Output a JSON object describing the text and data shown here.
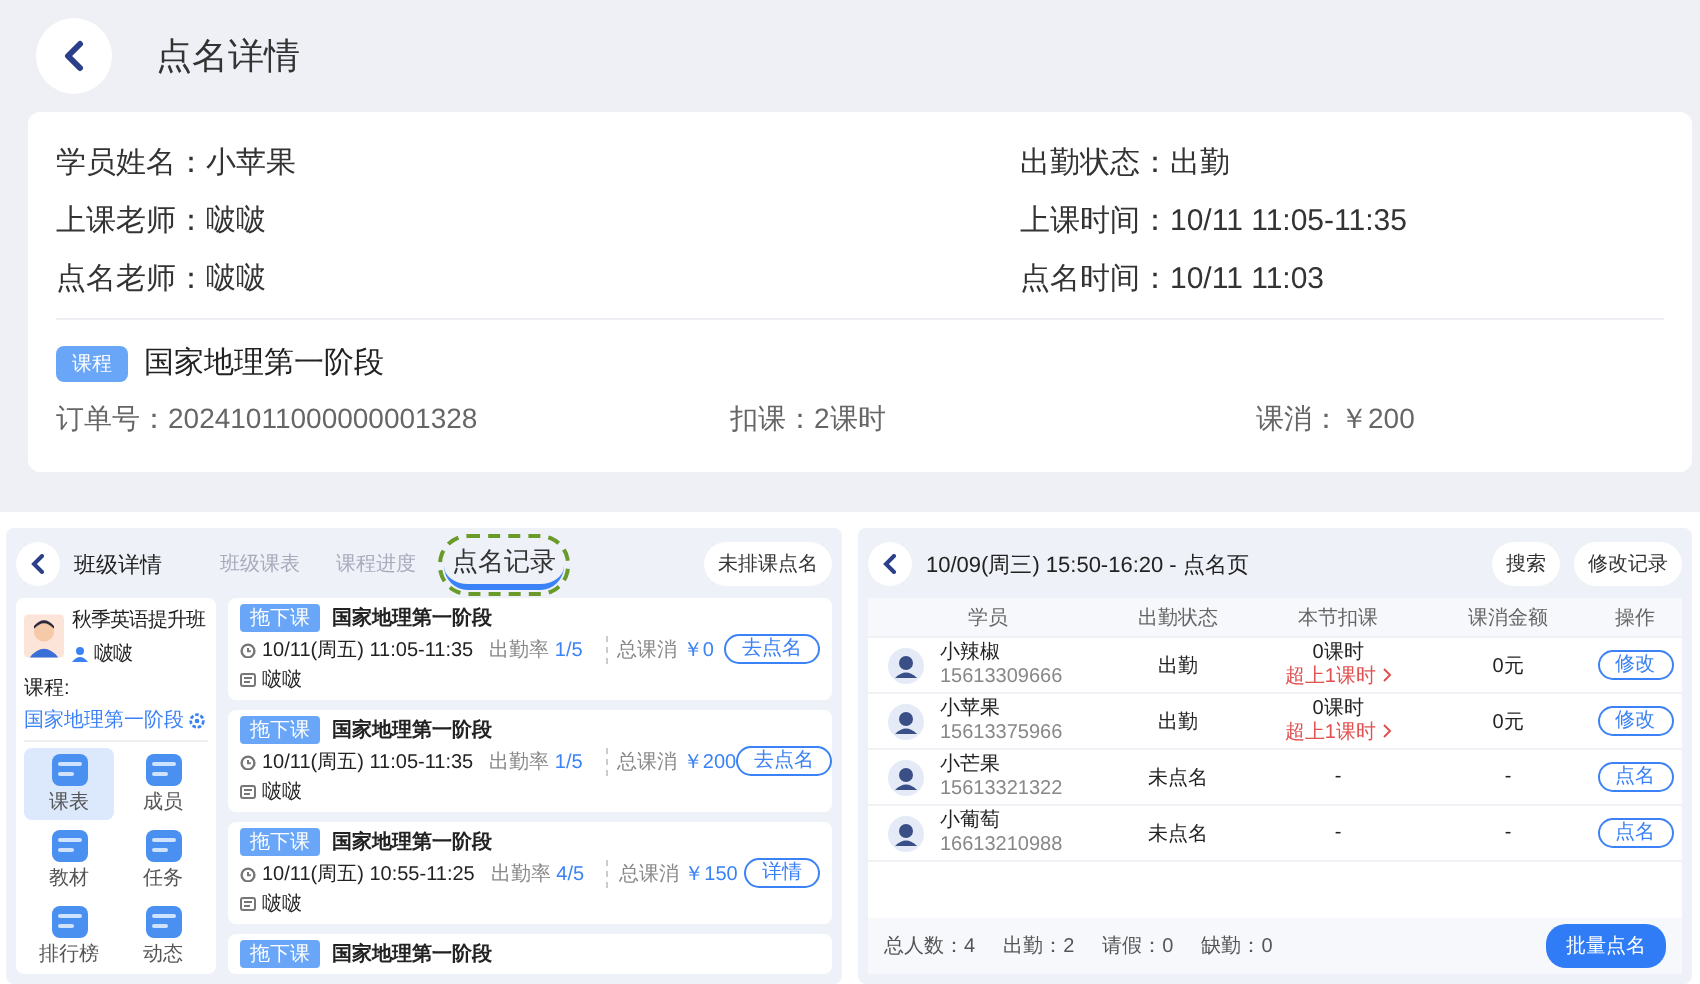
{
  "header": {
    "title": "点名详情"
  },
  "detail": {
    "fields": [
      {
        "label": "学员姓名：",
        "value": "小苹果"
      },
      {
        "label": "出勤状态：",
        "value": "出勤"
      },
      {
        "label": "上课老师：",
        "value": "啵啵"
      },
      {
        "label": "上课时间：",
        "value": "10/11 11:05-11:35"
      },
      {
        "label": "点名老师：",
        "value": "啵啵"
      },
      {
        "label": "点名时间：",
        "value": "10/11 11:03"
      }
    ],
    "course_tag": "课程",
    "course": "国家地理第一阶段",
    "meta": [
      {
        "label": "订单号：",
        "value": "20241011000000001328"
      },
      {
        "label": "扣课：",
        "value": "2课时"
      },
      {
        "label": "课消：",
        "value": "￥200"
      }
    ]
  },
  "class_panel": {
    "title": "班级详情",
    "tabs": [
      {
        "label": "班级课表",
        "selected": false,
        "circled": false
      },
      {
        "label": "课程进度",
        "selected": false,
        "circled": false
      },
      {
        "label": "点名记录",
        "selected": true,
        "circled": true
      }
    ],
    "action": "未排课点名",
    "class_name": "秋季英语提升班",
    "teacher": "啵啵",
    "course_label": "课程:",
    "course": "国家地理第一阶段",
    "menu": [
      {
        "label": "课表",
        "selected": true
      },
      {
        "label": "成员",
        "selected": false
      },
      {
        "label": "教材",
        "selected": false
      },
      {
        "label": "任务",
        "selected": false
      },
      {
        "label": "排行榜",
        "selected": false
      },
      {
        "label": "动态",
        "selected": false
      }
    ],
    "records": [
      {
        "tag": "拖下课",
        "title": "国家地理第一阶段",
        "time": "10/11(周五) 11:05-11:35",
        "teacher": "啵啵",
        "rate_label": "出勤率",
        "rate": "1/5",
        "total_label": "总课消",
        "total": "￥0",
        "action": "去点名"
      },
      {
        "tag": "拖下课",
        "title": "国家地理第一阶段",
        "time": "10/11(周五) 11:05-11:35",
        "teacher": "啵啵",
        "rate_label": "出勤率",
        "rate": "1/5",
        "total_label": "总课消",
        "total": "￥200",
        "action": "去点名"
      },
      {
        "tag": "拖下课",
        "title": "国家地理第一阶段",
        "time": "10/11(周五) 10:55-11:25",
        "teacher": "啵啵",
        "rate_label": "出勤率",
        "rate": "4/5",
        "total_label": "总课消",
        "total": "￥150",
        "action": "详情"
      },
      {
        "tag": "拖下课",
        "title": "国家地理第一阶段"
      }
    ]
  },
  "roll_panel": {
    "title": "10/09(周三) 15:50-16:20 - 点名页",
    "buttons": [
      "搜索",
      "修改记录"
    ],
    "columns": [
      "学员",
      "出勤状态",
      "本节扣课",
      "课消金额",
      "操作"
    ],
    "rows": [
      {
        "name": "小辣椒",
        "phone": "15613309666",
        "status": "出勤",
        "deduct": "0课时",
        "deduct_note": "超上1课时",
        "amount": "0元",
        "action": "修改"
      },
      {
        "name": "小苹果",
        "phone": "15613375966",
        "status": "出勤",
        "deduct": "0课时",
        "deduct_note": "超上1课时",
        "amount": "0元",
        "action": "修改"
      },
      {
        "name": "小芒果",
        "phone": "15613321322",
        "status": "未点名",
        "deduct": "-",
        "amount": "-",
        "action": "点名"
      },
      {
        "name": "小葡萄",
        "phone": "16613210988",
        "status": "未点名",
        "deduct": "-",
        "amount": "-",
        "action": "点名"
      }
    ],
    "summary": [
      {
        "label": "总人数：",
        "value": "4"
      },
      {
        "label": "出勤：",
        "value": "2"
      },
      {
        "label": "请假：",
        "value": "0"
      },
      {
        "label": "缺勤：",
        "value": "0"
      }
    ],
    "submit": "批量点名"
  }
}
